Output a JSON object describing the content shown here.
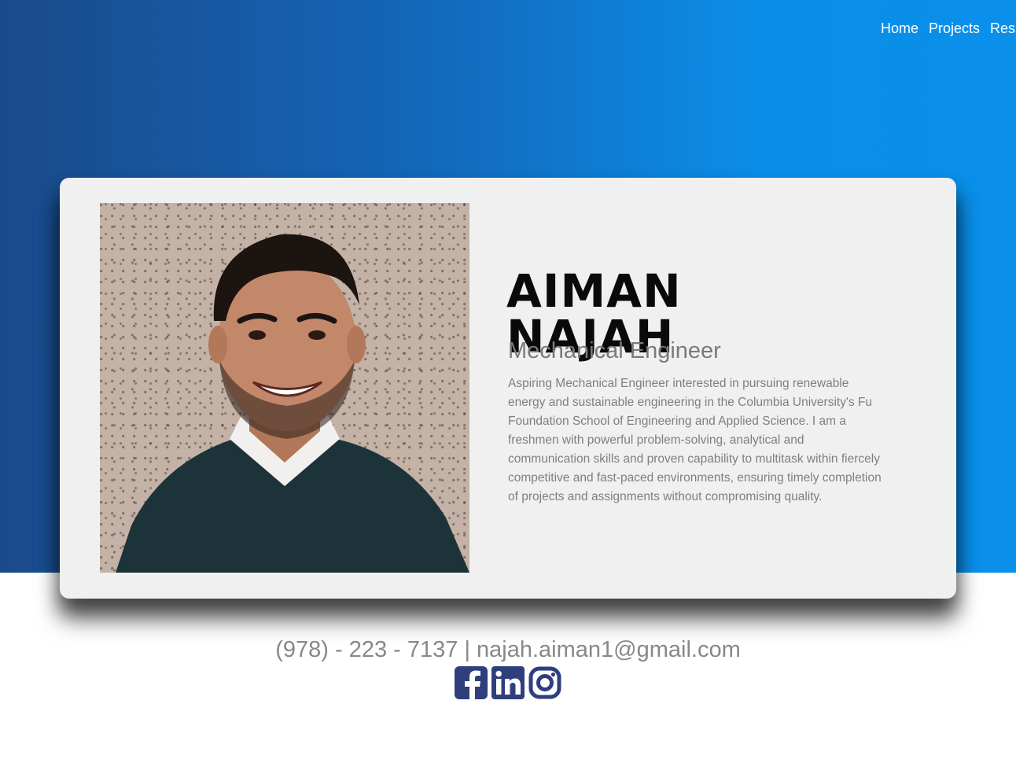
{
  "nav": {
    "items": [
      "Home",
      "Projects",
      "Resume"
    ]
  },
  "profile": {
    "first_name": "AIMAN",
    "last_name": "NAJAH",
    "title": "Mechanical Engineer",
    "bio": "Aspiring Mechanical Engineer interested in pursuing renewable energy and sustainable engineering in the Columbia University's Fu Foundation School of Engineering and Applied Science. I am a freshmen with powerful problem-solving, analytical and communication skills and proven capability to multitask within fiercely competitive and fast-paced environments, ensuring timely completion of projects and assignments without compromising quality."
  },
  "contact": {
    "line": "(978) - 223 - 7137 | najah.aiman1@gmail.com"
  },
  "socials": [
    {
      "icon": "facebook-icon"
    },
    {
      "icon": "linkedin-icon"
    },
    {
      "icon": "instagram-icon"
    }
  ],
  "colors": {
    "hero_start": "#1a4a8a",
    "hero_end": "#0a90ea",
    "card_bg": "#f0f0f0",
    "social_icon": "#2e3f7c"
  }
}
